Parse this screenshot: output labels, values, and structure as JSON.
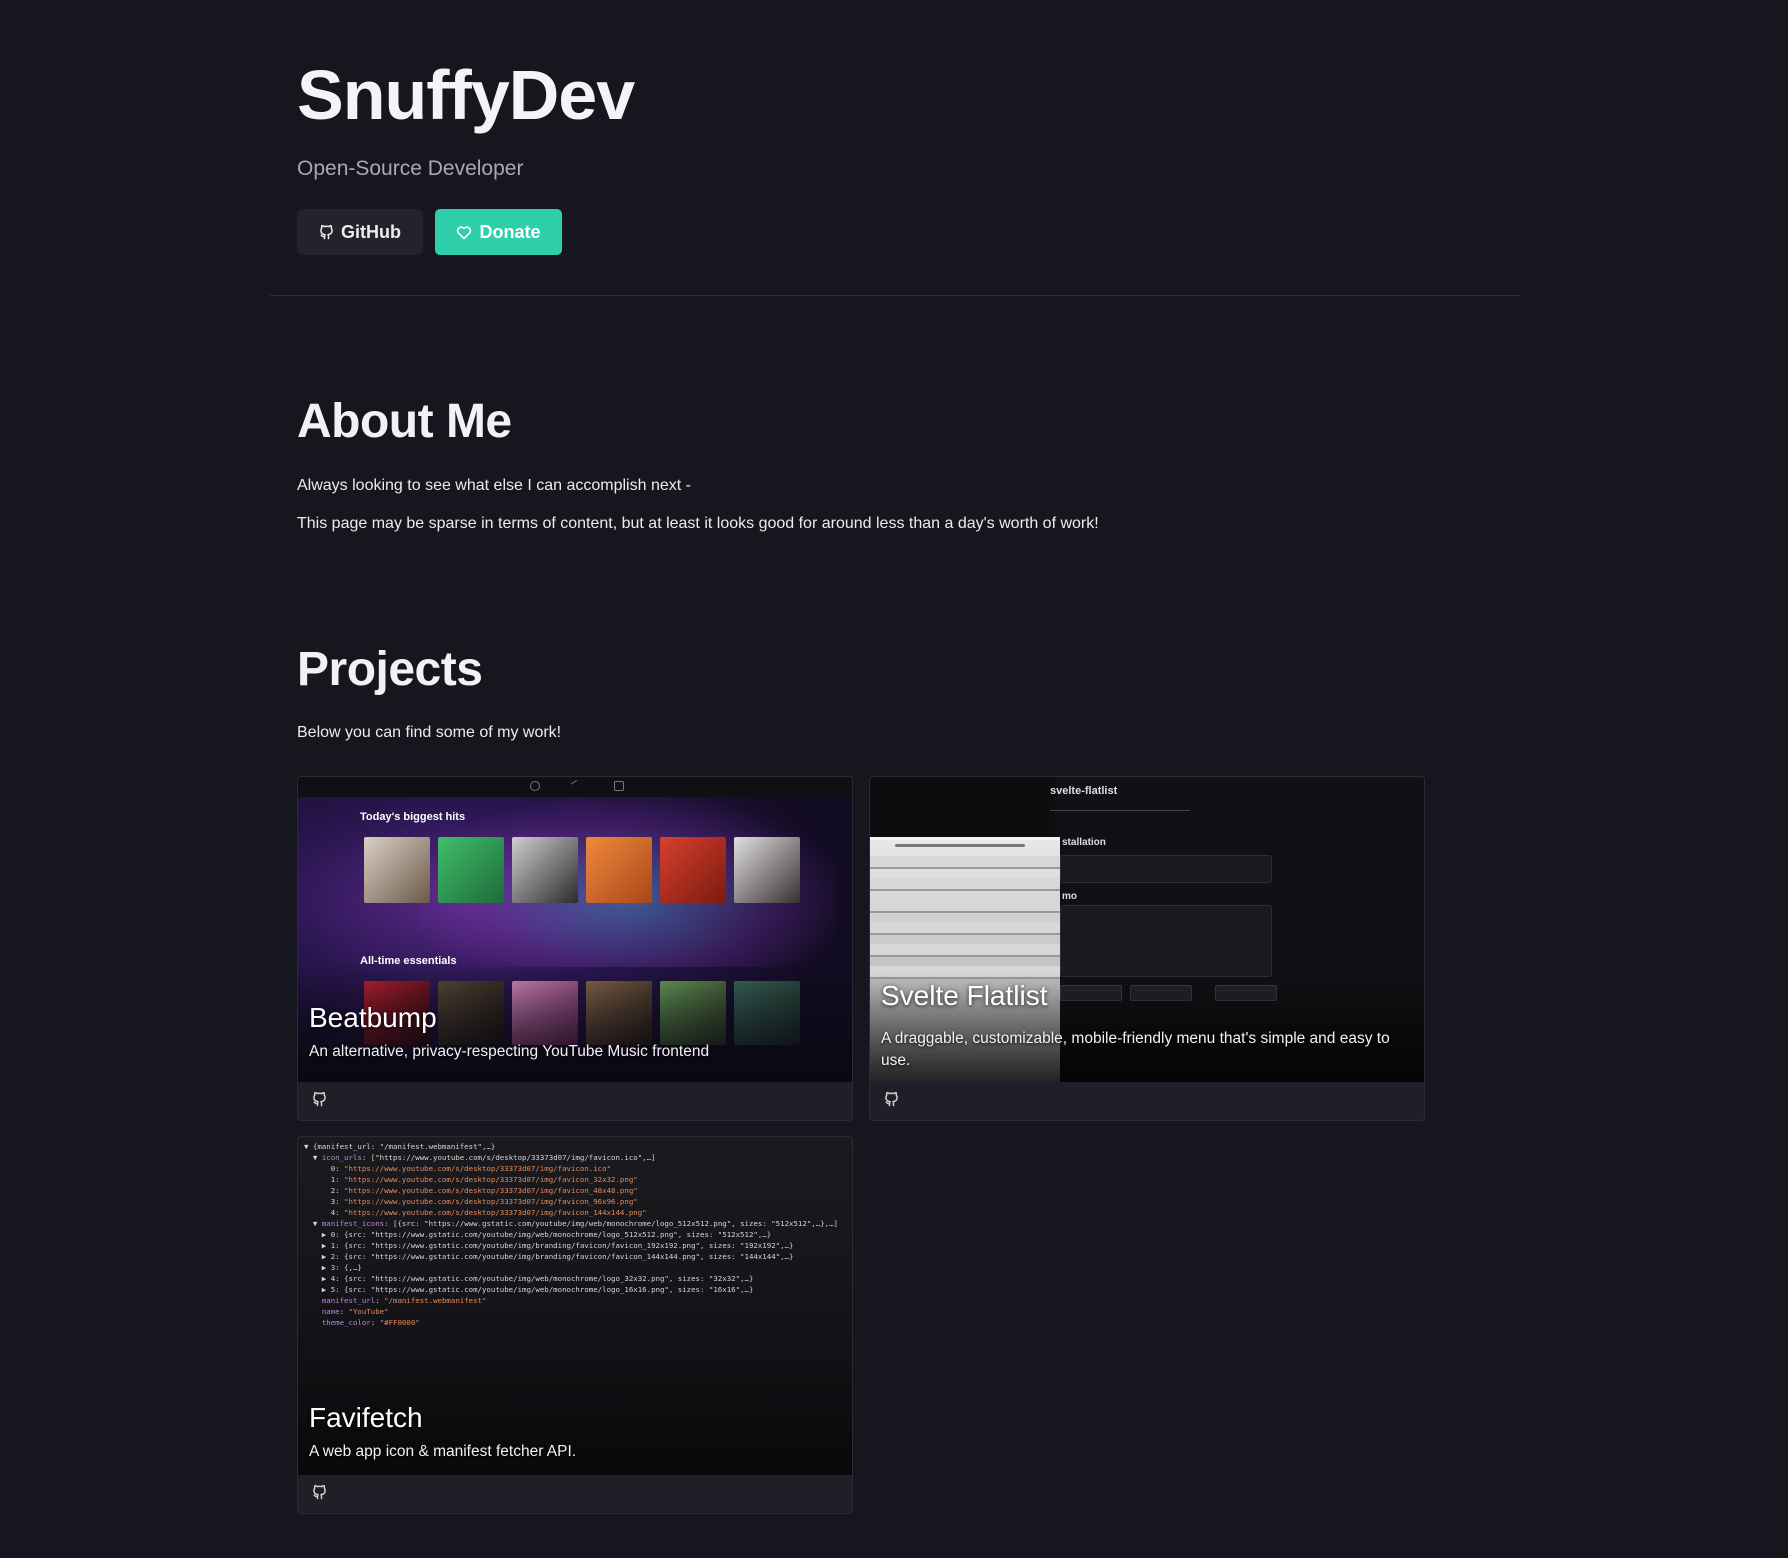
{
  "header": {
    "title": "SnuffyDev",
    "subtitle": "Open-Source Developer",
    "github_label": "GitHub",
    "donate_label": "Donate"
  },
  "about": {
    "heading": "About Me",
    "line1": "Always looking to see what else I can accomplish next -",
    "line2": "This page may be sparse in terms of content, but at least it looks good for around less than a day's worth of work!"
  },
  "projects": {
    "heading": "Projects",
    "intro": "Below you can find some of my work!",
    "items": [
      {
        "title": "Beatbump",
        "description": "An alternative, privacy-respecting YouTube Music frontend",
        "preview": {
          "heading1": "Today's biggest hits",
          "heading2": "All-time essentials"
        }
      },
      {
        "title": "Svelte Flatlist",
        "description": "A draggable, customizable, mobile-friendly menu that's simple and easy to use.",
        "preview": {
          "heading": "svelte-flatlist",
          "installation": "stallation",
          "demo": "mo"
        }
      },
      {
        "title": "Favifetch",
        "description": "A web app icon & manifest fetcher API."
      }
    ]
  },
  "colors": {
    "background": "#16161e",
    "accent": "#2fcfab",
    "card": "#1f1f27"
  },
  "icons": {
    "github": "github-icon",
    "donate": "heart-icon"
  }
}
